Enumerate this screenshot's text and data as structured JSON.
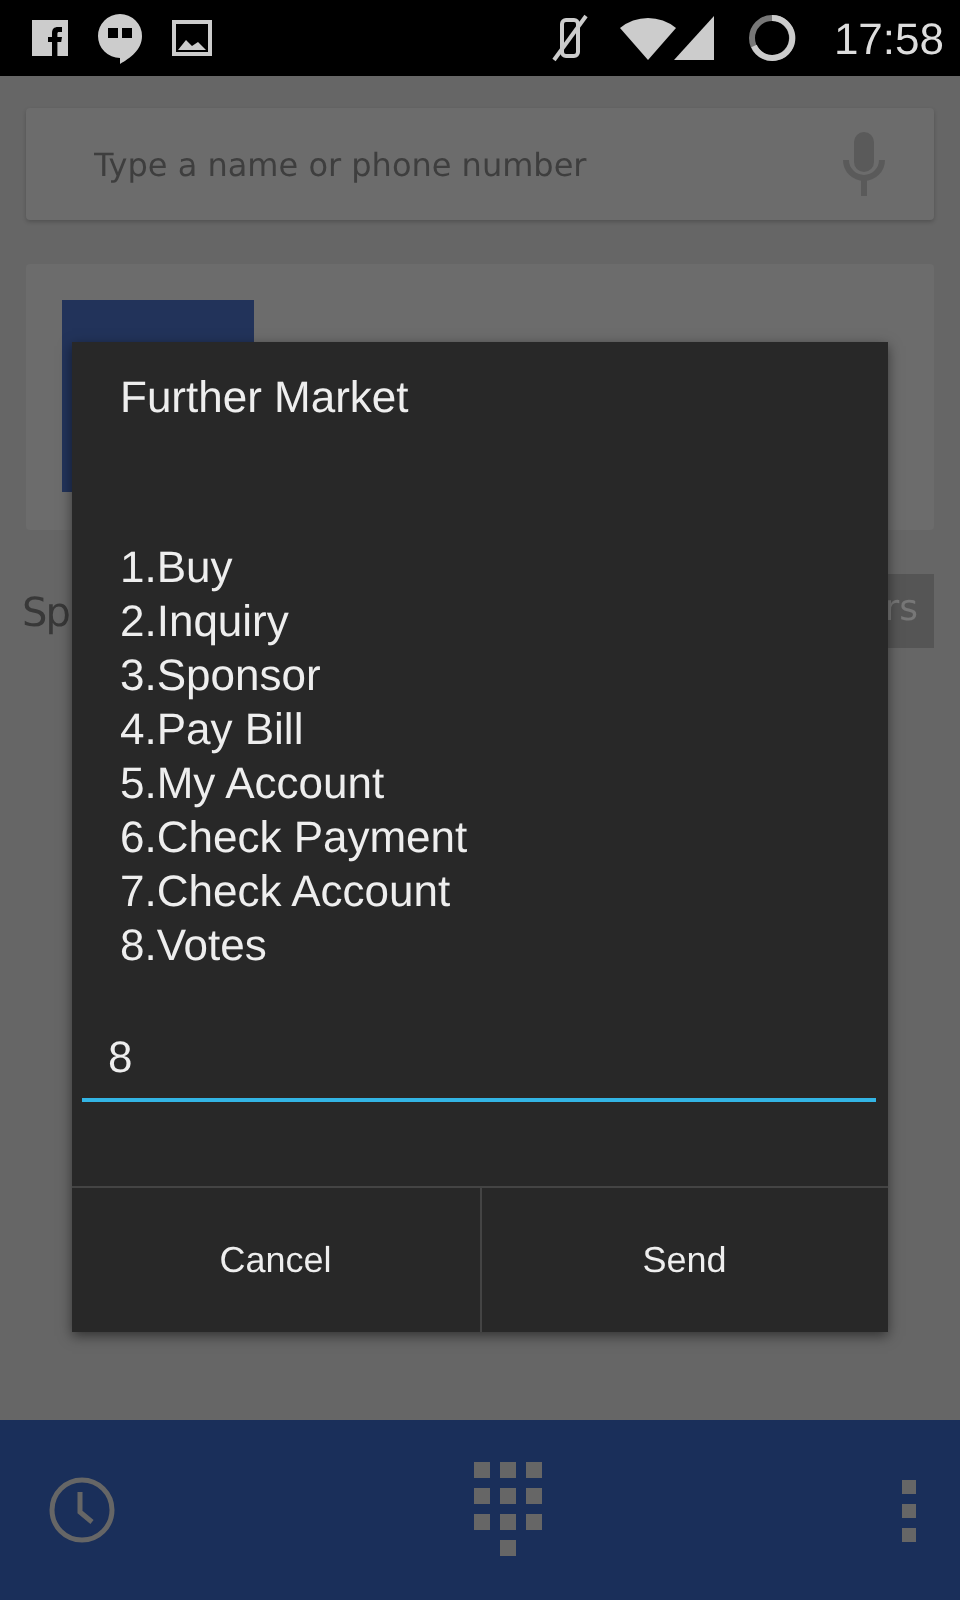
{
  "status_bar": {
    "time": "17:58"
  },
  "search": {
    "placeholder": "Type a name or phone number"
  },
  "background": {
    "label_fragment": "Sp",
    "button_fragment": "rs"
  },
  "dialog": {
    "title": "Further Market",
    "message_lines": [
      "1.Buy",
      "2.Inquiry",
      "3.Sponsor",
      "4.Pay Bill",
      "5.My Account",
      "6.Check Payment",
      "7.Check Account",
      "8.Votes"
    ],
    "input_value": "8",
    "buttons": [
      "Cancel",
      "Send"
    ]
  }
}
